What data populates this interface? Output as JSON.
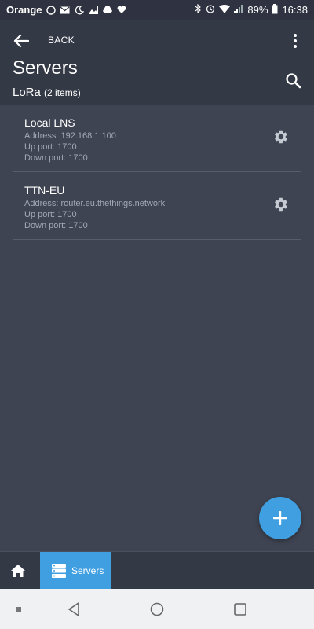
{
  "status_bar": {
    "carrier": "Orange",
    "battery": "89%",
    "time": "16:38",
    "icons": [
      "whatsapp-icon",
      "gmail-icon",
      "moon-icon",
      "image-icon",
      "drive-icon",
      "heart-icon"
    ]
  },
  "app_bar": {
    "back_label": "BACK",
    "title": "Servers",
    "subtitle_main": "LoRa",
    "subtitle_count": "(2 items)"
  },
  "servers": [
    {
      "name": "Local LNS",
      "address": "Address: 192.168.1.100",
      "up_port": "Up port: 1700",
      "down_port": "Down port: 1700"
    },
    {
      "name": "TTN-EU",
      "address": "Address: router.eu.thethings.network",
      "up_port": "Up port: 1700",
      "down_port": "Down port: 1700"
    }
  ],
  "bottom_nav": {
    "servers_label": "Servers"
  },
  "colors": {
    "background": "#3f4452",
    "appbar": "#343946",
    "accent": "#3f9fe0"
  }
}
